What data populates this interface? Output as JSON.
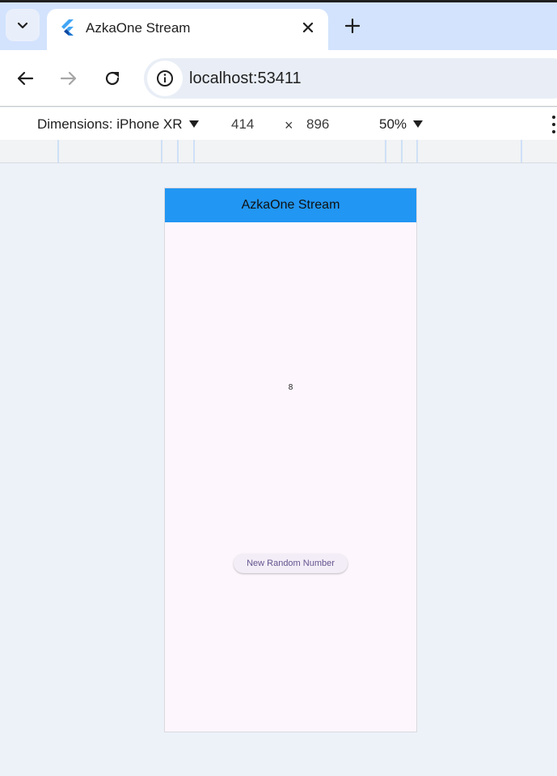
{
  "browser": {
    "tab": {
      "title": "AzkaOne Stream",
      "favicon": "flutter-icon"
    },
    "tab_search_icon": "chevron-down-icon",
    "close_tab_icon": "close-icon",
    "new_tab_icon": "plus-icon",
    "nav": {
      "back_icon": "arrow-left-icon",
      "forward_icon": "arrow-right-icon",
      "reload_icon": "reload-icon"
    },
    "address": {
      "site_info_icon": "info-icon",
      "url": "localhost:53411"
    }
  },
  "device_toolbar": {
    "dimensions_label": "Dimensions: iPhone XR",
    "width": "414",
    "times": "×",
    "height": "896",
    "zoom": "50%",
    "more_icon": "more-vertical-icon"
  },
  "app": {
    "title": "AzkaOne Stream",
    "number": "8",
    "button_label": "New Random Number"
  },
  "colors": {
    "tabstrip": "#d3e3fd",
    "appbar": "#2196f3",
    "app_background": "#fdf7fd",
    "button_background": "#f3edf7",
    "button_text": "#65558f",
    "page_background": "#edf2f9"
  }
}
